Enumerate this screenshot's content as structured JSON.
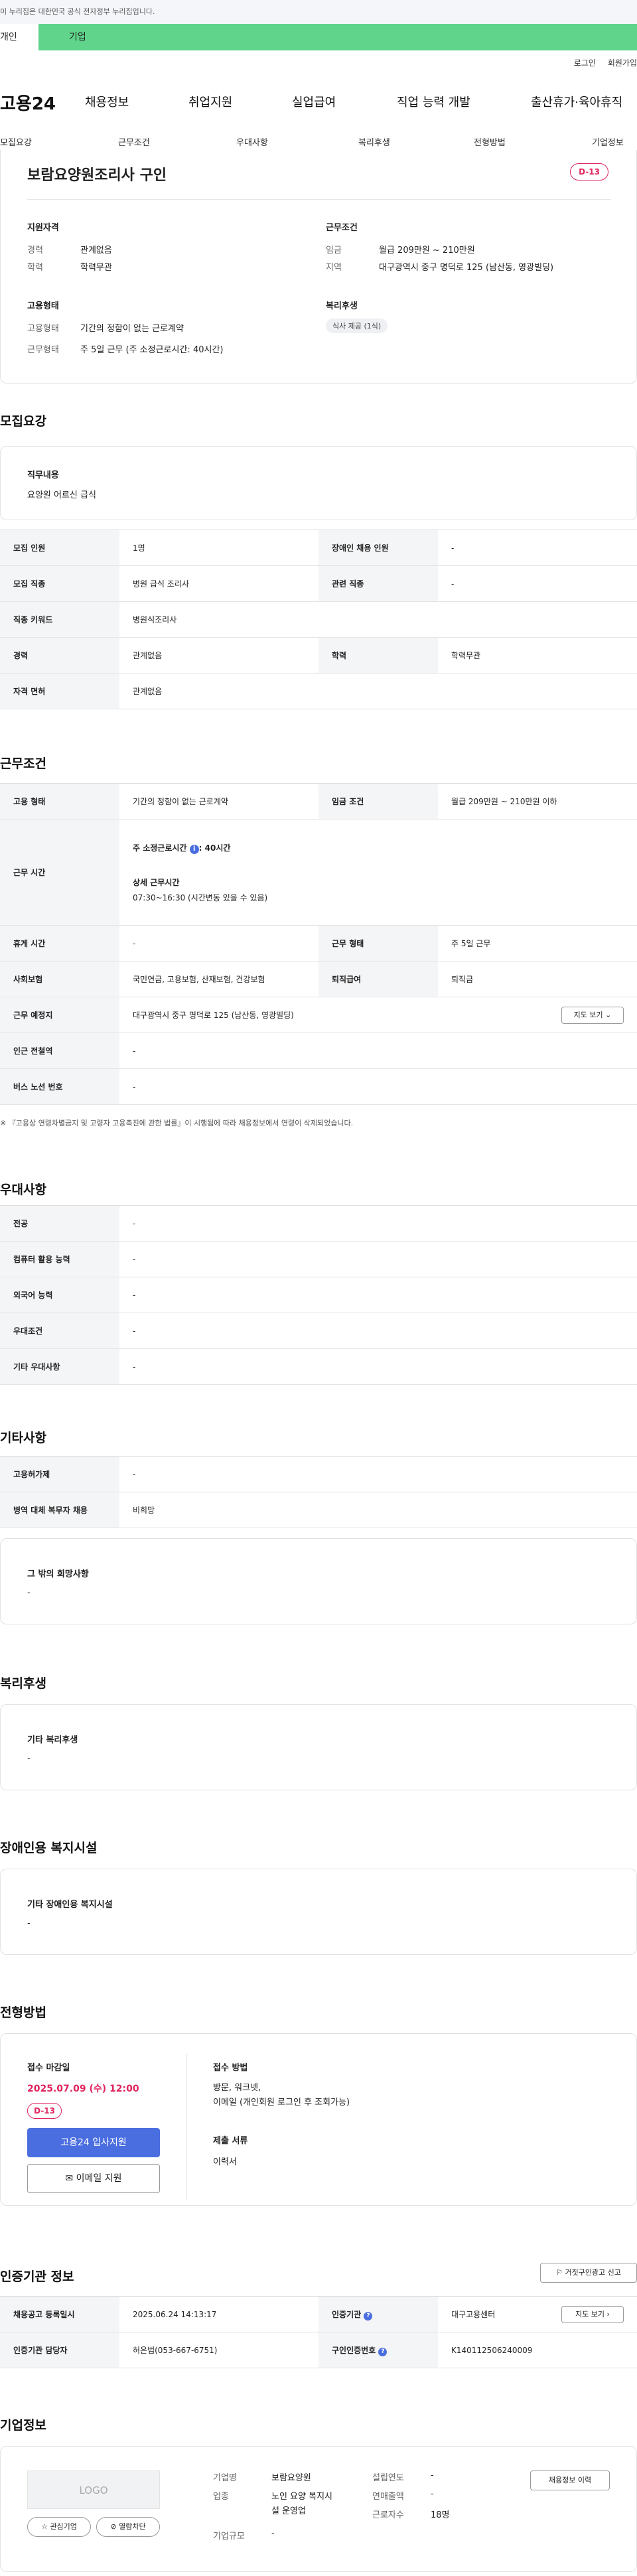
{
  "notice": "이 누리집은 대한민국 공식 전자정부 누리집입니다.",
  "user_tabs": [
    "개인",
    "기업"
  ],
  "top_links": [
    "로그인",
    "회원가입"
  ],
  "logo": "고용24",
  "gnb": [
    "채용정보",
    "취업지원",
    "실업급여",
    "직업 능력 개발",
    "출산휴가·육아휴직"
  ],
  "subnav": [
    "모집요강",
    "근무조건",
    "우대사항",
    "복리후생",
    "전형방법",
    "기업정보"
  ],
  "summary": {
    "title": "보람요양원조리사 구인",
    "dday": "D-13",
    "qual_h": "지원자격",
    "career_l": "경력",
    "career_v": "관계없음",
    "edu_l": "학력",
    "edu_v": "학력무관",
    "cond_h": "근무조건",
    "wage_l": "임금",
    "wage_v": "월급 209만원 ~ 210만원",
    "area_l": "지역",
    "area_v": "대구광역시 중구 명덕로 125 (남산동, 영광빌딩)",
    "emp_h": "고용형태",
    "type_l": "고용형태",
    "type_v": "기간의 정함이 없는 근로계약",
    "work_l": "근무형태",
    "work_v": "주 5일 근무 (주 소정근로시간: 40시간)",
    "welfare_h": "복리후생",
    "welfare_tag": "식사 제공 (1식)"
  },
  "recruit": {
    "heading": "모집요강",
    "duty_h": "직무내용",
    "duty_v": "요양원 어르신 급식",
    "rows": [
      {
        "a": "모집 인원",
        "b": "1명",
        "c": "장애인 채용 인원",
        "d": "-"
      },
      {
        "a": "모집 직종",
        "b": "병원 급식 조리사",
        "c": "관련 직종",
        "d": "-"
      },
      {
        "a": "직종 키워드",
        "b": "병원식조리사",
        "c": "",
        "d": ""
      },
      {
        "a": "경력",
        "b": "관계없음",
        "c": "학력",
        "d": "학력무관"
      },
      {
        "a": "자격 면허",
        "b": "관계없음",
        "c": "",
        "d": ""
      }
    ]
  },
  "work": {
    "heading": "근무조건",
    "type_l": "고용 형태",
    "type_v": "기간의 정함이 없는 근로계약",
    "wage_l": "임금 조건",
    "wage_v": "월급 209만원 ~ 210만원 이하",
    "hours_l": "근무 시간",
    "hours_main": "주 소정근로시간",
    "hours_main_v": ": 40시간",
    "hours_detail_h": "상세 근무시간",
    "hours_detail_v": "07:30~16:30 (시간변동 있을 수 있음)",
    "rest_l": "휴게 시간",
    "rest_v": "-",
    "form_l": "근무 형태",
    "form_v": "주 5일 근무",
    "ins_l": "사회보험",
    "ins_v": "국민연금, 고용보험, 산재보험, 건강보험",
    "ret_l": "퇴직급여",
    "ret_v": "퇴직금",
    "place_l": "근무 예정지",
    "place_v": "대구광역시 중구 명덕로 125 (남산동, 영광빌딩)",
    "map_btn": "지도 보기",
    "subway_l": "인근 전철역",
    "subway_v": "-",
    "bus_l": "버스 노선 번호",
    "bus_v": "-",
    "note": "※ 『고용상 연령차별금지 및 고령자 고용촉진에 관한 법률』이 시행됨에 따라 채용정보에서 연령이 삭제되었습니다."
  },
  "pref": {
    "heading": "우대사항",
    "rows": [
      {
        "a": "전공",
        "b": "-"
      },
      {
        "a": "컴퓨터 활용 능력",
        "b": "-"
      },
      {
        "a": "외국어 능력",
        "b": "-"
      },
      {
        "a": "우대조건",
        "b": "-"
      },
      {
        "a": "기타 우대사항",
        "b": "-"
      }
    ]
  },
  "etc": {
    "heading": "기타사항",
    "rows": [
      {
        "a": "고용허가제",
        "b": "-"
      },
      {
        "a": "병역 대체 복무자 채용",
        "b": "비희망"
      }
    ],
    "other_h": "그 밖의 희망사항",
    "other_v": "-"
  },
  "welfare": {
    "heading": "복리후생",
    "box_h": "기타 복리후생",
    "box_v": "-"
  },
  "disabled": {
    "heading": "장애인용 복지시설",
    "box_h": "기타 장애인용 복지시설",
    "box_v": "-"
  },
  "process": {
    "heading": "전형방법",
    "deadline_h": "접수 마감일",
    "deadline_v": "2025.07.09 (수) 12:00",
    "dday": "D-13",
    "apply_btn": "고용24 입사지원",
    "email_btn": "이메일 지원",
    "method_h": "접수 방법",
    "method_v1": "방문, 워크넷,",
    "method_v2": "이메일 (개인회원 로그인 후 조회가능)",
    "docs_h": "제출 서류",
    "docs_v": "이력서"
  },
  "cert": {
    "heading": "인증기관 정보",
    "report_btn": "거짓구인광고 신고",
    "reg_l": "채용공고 등록일시",
    "reg_v": "2025.06.24 14:13:17",
    "org_l": "인증기관",
    "org_v": "대구고용센터",
    "map_btn": "지도 보기",
    "mgr_l": "인증기관 담당자",
    "mgr_v": "허은범(053-667-6751)",
    "num_l": "구인인증번호",
    "num_v": "K140112506240009"
  },
  "company": {
    "heading": "기업정보",
    "logo": "LOGO",
    "fav": "관심기업",
    "block": "열람차단",
    "name_l": "기업명",
    "name_v": "보람요양원",
    "ind_l": "업종",
    "ind_v1": "노인 요양 복지시",
    "ind_v2": "설 운영업",
    "size_l": "기업규모",
    "size_v": "-",
    "year_l": "설립연도",
    "year_v": "-",
    "sales_l": "연매출액",
    "sales_v": "-",
    "emp_l": "근로자수",
    "emp_v": "18명",
    "info_btn": "채용정보 이력"
  },
  "colors": {
    "accent": "#4a6ee0",
    "green": "#5fd48a",
    "dday": "#e0245e",
    "deadline": "#e0245e"
  }
}
